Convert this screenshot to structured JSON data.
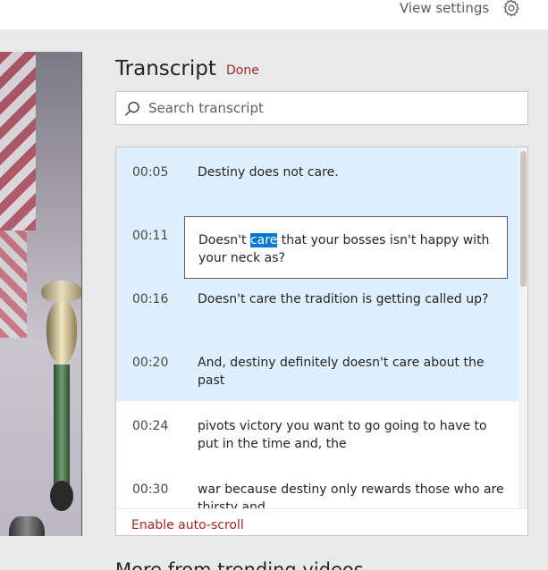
{
  "header": {
    "view_settings_label": "View settings",
    "settings_icon": "gear-icon"
  },
  "transcript": {
    "title": "Transcript",
    "done_label": "Done",
    "search": {
      "placeholder": "Search transcript",
      "value": "",
      "icon": "search-icon"
    },
    "rows": [
      {
        "time": "00:05",
        "text": "Destiny does not care.",
        "highlighted": true
      },
      {
        "time": "00:11",
        "text_before": "Doesn't ",
        "text_selected": "care",
        "text_after": " that your bosses isn't happy with your neck as?",
        "highlighted": true,
        "editing": true
      },
      {
        "time": "00:16",
        "text": "Doesn't care the tradition is getting called up?",
        "highlighted": true
      },
      {
        "time": "00:20",
        "text": "And, destiny definitely doesn't care about the past",
        "highlighted": true
      },
      {
        "time": "00:24",
        "text": "pivots victory you want to go going to have to put in the time and, the",
        "highlighted": false
      },
      {
        "time": "00:30",
        "text": "war because destiny only rewards those who are thirsty and.",
        "highlighted": false
      }
    ],
    "autoscroll_label": "Enable auto-scroll"
  },
  "more_section": {
    "title": "More from trending videos"
  },
  "colors": {
    "accent": "#a4262c",
    "highlight_row": "#def0fe",
    "selection": "#0078d4"
  }
}
